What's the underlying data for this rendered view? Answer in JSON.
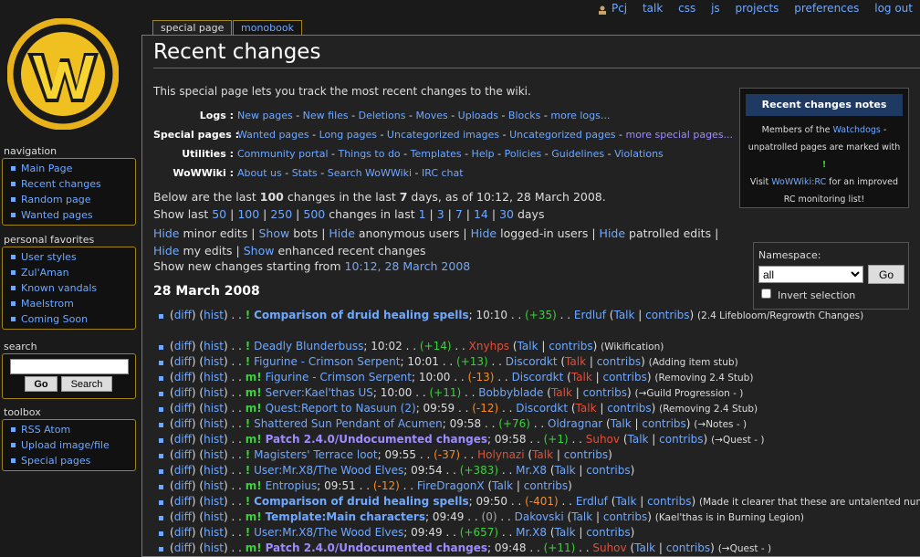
{
  "personal_bar": {
    "user": "Pcj",
    "items": [
      "talk",
      "css",
      "js",
      "projects",
      "preferences",
      "log out"
    ]
  },
  "tabs": {
    "special_page": "special page",
    "monobook": "monobook"
  },
  "title": "Recent changes",
  "intro": "This special page lets you track the most recent changes to the wiki.",
  "link_rows": [
    {
      "label": "Logs :",
      "links": [
        "New pages",
        "New files",
        "Deletions",
        "Moves",
        "Uploads",
        "Blocks",
        "more logs..."
      ]
    },
    {
      "label": "Special pages :",
      "links": [
        "Wanted pages",
        "Long pages",
        "Uncategorized images",
        "Uncategorized pages",
        "more special pages..."
      ]
    },
    {
      "label": "Utilities :",
      "links": [
        "Community portal",
        "Things to do",
        "Templates",
        "Help",
        "Policies",
        "Guidelines",
        "Violations"
      ]
    },
    {
      "label": "WoWWiki :",
      "links": [
        "About us",
        "Stats",
        "Search WoWWiki",
        "IRC chat"
      ]
    }
  ],
  "notes": {
    "title": "Recent changes notes",
    "line1_pre": "Members of the ",
    "line1_link": "Watchdogs",
    "line1_post": " - unpatrolled pages are marked with ",
    "mark": "!",
    "line2_pre": "Visit ",
    "line2_link": "WoWWiki:RC",
    "line2_post": " for an improved RC monitoring list!"
  },
  "summary": {
    "pre": "Below are the last ",
    "count": "100",
    "mid": " changes in the last ",
    "days": "7",
    "post": " days, as of 10:12, 28 March 2008."
  },
  "show_last": {
    "label": "Show last",
    "counts": [
      "50",
      "100",
      "250",
      "500"
    ],
    "mid": "changes in last",
    "days": [
      "1",
      "3",
      "7",
      "14",
      "30"
    ],
    "post": "days"
  },
  "toggles": [
    {
      "link": "Hide",
      "text": "minor edits"
    },
    {
      "link": "Show",
      "text": "bots"
    },
    {
      "link": "Hide",
      "text": "anonymous users"
    },
    {
      "link": "Hide",
      "text": "logged-in users"
    },
    {
      "link": "Hide",
      "text": "patrolled edits"
    },
    {
      "link": "Hide",
      "text": "my edits"
    },
    {
      "link": "Show",
      "text": "enhanced recent changes"
    }
  ],
  "new_from": {
    "label": "Show new changes starting from",
    "link": "10:12, 28 March 2008"
  },
  "namespace": {
    "label": "Namespace:",
    "value": "all",
    "go": "Go",
    "invert": "Invert selection"
  },
  "date_heading": "28 March 2008",
  "diff": "diff",
  "hist": "hist",
  "changes": [
    {
      "flag": "!",
      "title": "Comparison of druid healing spells",
      "bold": true,
      "time": "10:10",
      "delta": "(+35)",
      "dclass": "pos",
      "user": "Erdluf",
      "ured": false,
      "talk": "Talk",
      "tred": false,
      "summary": "(2.4 Lifebloom/Regrowth Changes)",
      "two": true
    },
    {
      "flag": "!",
      "title": "Deadly Blunderbuss",
      "time": "10:02",
      "delta": "(+14)",
      "dclass": "pos",
      "user": "Xnyhps",
      "ured": true,
      "talk": "Talk",
      "tred": false,
      "summary": "(Wikification)"
    },
    {
      "flag": "!",
      "title": "Figurine - Crimson Serpent",
      "time": "10:01",
      "delta": "(+13)",
      "dclass": "pos",
      "user": "Discordkt",
      "ured": false,
      "talk": "Talk",
      "tred": true,
      "summary": "(Adding item stub)"
    },
    {
      "flag": "m!",
      "title": "Figurine - Crimson Serpent",
      "time": "10:00",
      "delta": "(-13)",
      "dclass": "neg",
      "user": "Discordkt",
      "ured": false,
      "talk": "Talk",
      "tred": true,
      "summary": "(Removing 2.4 Stub)"
    },
    {
      "flag": "m!",
      "title": "Server:Kael'thas US",
      "time": "10:00",
      "delta": "(+11)",
      "dclass": "pos",
      "user": "Bobbyblade",
      "ured": false,
      "talk": "Talk",
      "tred": true,
      "summary": "(→Guild Progression - )",
      "sarrow": true
    },
    {
      "flag": "m!",
      "title": "Quest:Report to Nasuun (2)",
      "time": "09:59",
      "delta": "(-12)",
      "dclass": "neg",
      "user": "Discordkt",
      "ured": false,
      "talk": "Talk",
      "tred": true,
      "summary": "(Removing 2.4 Stub)"
    },
    {
      "flag": "!",
      "title": "Shattered Sun Pendant of Acumen",
      "time": "09:58",
      "delta": "(+76)",
      "dclass": "pos",
      "user": "Oldragnar",
      "ured": false,
      "talk": "Talk",
      "tred": false,
      "summary": "(→Notes - )",
      "sarrow": true
    },
    {
      "flag": "m!",
      "title": "Patch 2.4.0/Undocumented changes",
      "bold": true,
      "visited": true,
      "time": "09:58",
      "delta": "(+1)",
      "dclass": "pos",
      "user": "Suhov",
      "ured": true,
      "talk": "Talk",
      "tred": false,
      "summary": "(→Quest - )",
      "sarrow": true
    },
    {
      "flag": "!",
      "title": "Magisters' Terrace loot",
      "time": "09:55",
      "delta": "(-37)",
      "dclass": "neg",
      "user": "Holynazi",
      "ured": true,
      "talk": "Talk",
      "tred": true,
      "summary": ""
    },
    {
      "flag": "!",
      "title": "User:Mr.X8/The Wood Elves",
      "time": "09:54",
      "delta": "(+383)",
      "dclass": "pos",
      "user": "Mr.X8",
      "ured": false,
      "talk": "Talk",
      "tred": false,
      "summary": ""
    },
    {
      "flag": "m!",
      "title": "Entropius",
      "time": "09:51",
      "delta": "(-12)",
      "dclass": "neg",
      "user": "FireDragonX",
      "ured": false,
      "talk": "Talk",
      "tred": false,
      "summary": ""
    },
    {
      "flag": "!",
      "title": "Comparison of druid healing spells",
      "bold": true,
      "time": "09:50",
      "delta": "(-401)",
      "dclass": "neg",
      "user": "Erdluf",
      "ured": false,
      "talk": "Talk",
      "tred": false,
      "summary": "(Made it clearer that these are untalented numbers.)"
    },
    {
      "flag": "m!",
      "title": "Template:Main characters",
      "bold": true,
      "time": "09:49",
      "delta": "(0)",
      "dclass": "neu",
      "user": "Dakovski",
      "ured": false,
      "talk": "Talk",
      "tred": false,
      "summary": "(Kael'thas is in Burning Legion)"
    },
    {
      "flag": "!",
      "title": "User:Mr.X8/The Wood Elves",
      "time": "09:49",
      "delta": "(+657)",
      "dclass": "pos",
      "user": "Mr.X8",
      "ured": false,
      "talk": "Talk",
      "tred": false,
      "summary": ""
    },
    {
      "flag": "m!",
      "title": "Patch 2.4.0/Undocumented changes",
      "bold": true,
      "visited": true,
      "time": "09:48",
      "delta": "(+11)",
      "dclass": "pos",
      "user": "Suhov",
      "ured": true,
      "talk": "Talk",
      "tred": false,
      "summary": "(→Quest - )",
      "sarrow": true
    }
  ],
  "contribs": "contribs",
  "sidebar": {
    "navigation": {
      "header": "navigation",
      "items": [
        "Main Page",
        "Recent changes",
        "Random page",
        "Wanted pages"
      ]
    },
    "favorites": {
      "header": "personal favorites",
      "items": [
        "User styles",
        "Zul'Aman",
        "Known vandals",
        "Maelstrom",
        "Coming Soon"
      ]
    },
    "search": {
      "header": "search",
      "go": "Go",
      "search": "Search"
    },
    "toolbox": {
      "header": "toolbox",
      "items": [
        "RSS  Atom",
        "Upload image/file",
        "Special pages"
      ]
    }
  },
  "colors": {
    "accent": "#a08515",
    "link": "#6fa8ff",
    "bg": "#1a1a1a",
    "positive": "#3ad13a",
    "negative": "#ff8a1f",
    "redlink": "#e0503a"
  }
}
